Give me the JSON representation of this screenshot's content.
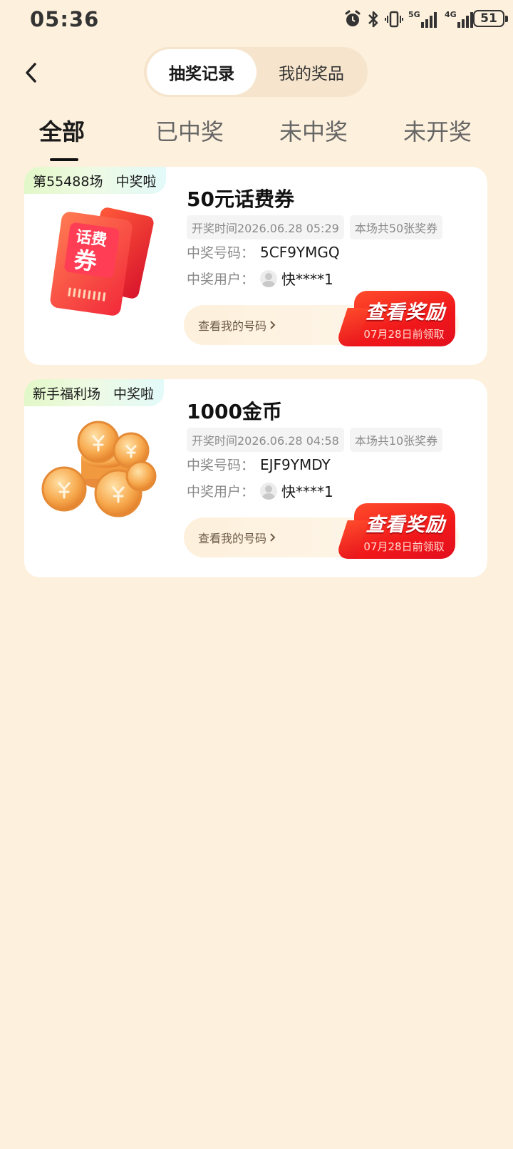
{
  "status_bar": {
    "time": "05:36",
    "network_1": "5G",
    "network_2": "4G",
    "battery": "51"
  },
  "header": {
    "segments": [
      {
        "label": "抽奖记录",
        "active": true
      },
      {
        "label": "我的奖品",
        "active": false
      }
    ]
  },
  "tabs": [
    {
      "label": "全部",
      "active": true
    },
    {
      "label": "已中奖",
      "active": false
    },
    {
      "label": "未中奖",
      "active": false
    },
    {
      "label": "未开奖",
      "active": false
    }
  ],
  "records": [
    {
      "session": "第55488场",
      "status": "中奖啦",
      "thumb_icon": "phone-bill-coupon-icon",
      "thumb_text_1": "话费",
      "thumb_text_2": "券",
      "prize": "50元话费券",
      "draw_time": "开奖时间2026.06.28 05:29",
      "ticket_count": "本场共50张奖券",
      "winning_code_label": "中奖号码：",
      "winning_code": "5CF9YMGQ",
      "winner_label": "中奖用户：",
      "winner": "快****1",
      "my_code_link": "查看我的号码",
      "reward_button": "查看奖励",
      "claim_deadline": "07月28日前领取"
    },
    {
      "session": "新手福利场",
      "status": "中奖啦",
      "thumb_icon": "gold-coins-icon",
      "prize": "1000金币",
      "draw_time": "开奖时间2026.06.28 04:58",
      "ticket_count": "本场共10张奖券",
      "winning_code_label": "中奖号码：",
      "winning_code": "EJF9YMDY",
      "winner_label": "中奖用户：",
      "winner": "快****1",
      "my_code_link": "查看我的号码",
      "reward_button": "查看奖励",
      "claim_deadline": "07月28日前领取"
    }
  ],
  "colors": {
    "background": "#fdf0dc",
    "reward_red": "#f0171a",
    "tag_green": "#e2f8c8"
  }
}
